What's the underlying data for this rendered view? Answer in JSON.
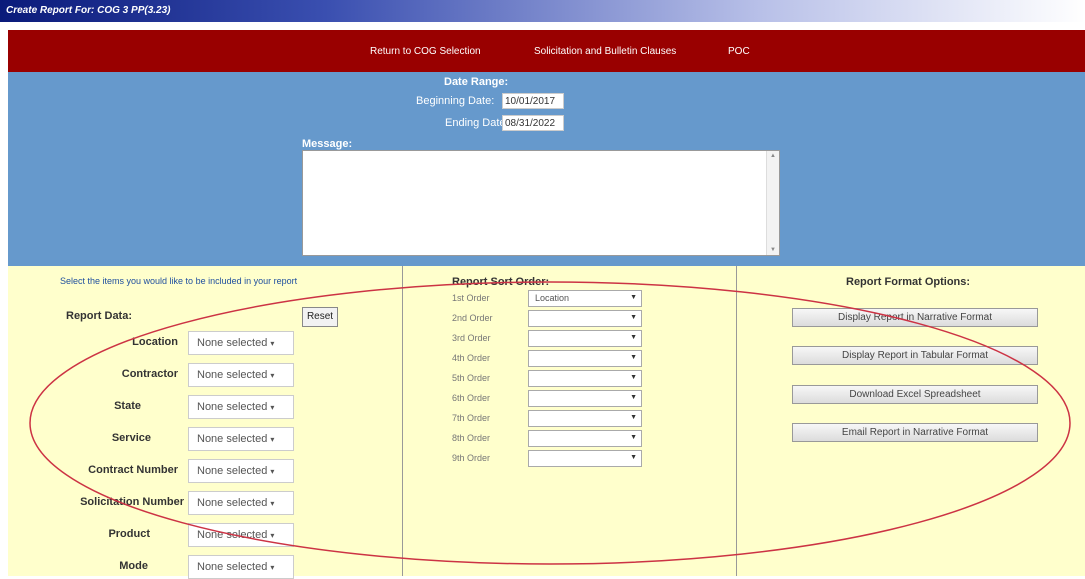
{
  "window": {
    "title": "Create Report For: COG 3 PP(3.23)"
  },
  "nav": {
    "links": [
      "Return to COG Selection",
      "Solicitation and Bulletin Clauses",
      "POC"
    ]
  },
  "date_range": {
    "heading": "Date Range:",
    "beginning_label": "Beginning Date:",
    "beginning_value": "10/01/2017",
    "ending_label": "Ending Date:",
    "ending_value": "08/31/2022"
  },
  "message": {
    "label": "Message:",
    "value": ""
  },
  "report_data": {
    "hint": "Select the items you would like to be included in your report",
    "title": "Report Data:",
    "reset_label": "Reset",
    "fields": [
      {
        "label": "Location",
        "value": "None selected"
      },
      {
        "label": "Contractor",
        "value": "None selected"
      },
      {
        "label": "State",
        "value": "None selected"
      },
      {
        "label": "Service",
        "value": "None selected"
      },
      {
        "label": "Contract Number",
        "value": "None selected"
      },
      {
        "label": "Solicitation Number",
        "value": "None selected"
      },
      {
        "label": "Product",
        "value": "None selected"
      },
      {
        "label": "Mode",
        "value": "None selected"
      }
    ]
  },
  "sort_order": {
    "title": "Report Sort Order:",
    "orders": [
      {
        "label": "1st Order",
        "value": "Location"
      },
      {
        "label": "2nd Order",
        "value": ""
      },
      {
        "label": "3rd Order",
        "value": ""
      },
      {
        "label": "4th Order",
        "value": ""
      },
      {
        "label": "5th Order",
        "value": ""
      },
      {
        "label": "6th Order",
        "value": ""
      },
      {
        "label": "7th Order",
        "value": ""
      },
      {
        "label": "8th Order",
        "value": ""
      },
      {
        "label": "9th Order",
        "value": ""
      }
    ]
  },
  "format_options": {
    "title": "Report Format Options:",
    "buttons": [
      "Display Report in Narrative Format",
      "Display Report in Tabular Format",
      "Download Excel Spreadsheet",
      "Email Report in Narrative Format"
    ]
  },
  "colors": {
    "nav_bg": "#990000",
    "header_bg": "#6699cc",
    "content_bg": "#ffffcc",
    "annotation": "#cc3344"
  }
}
